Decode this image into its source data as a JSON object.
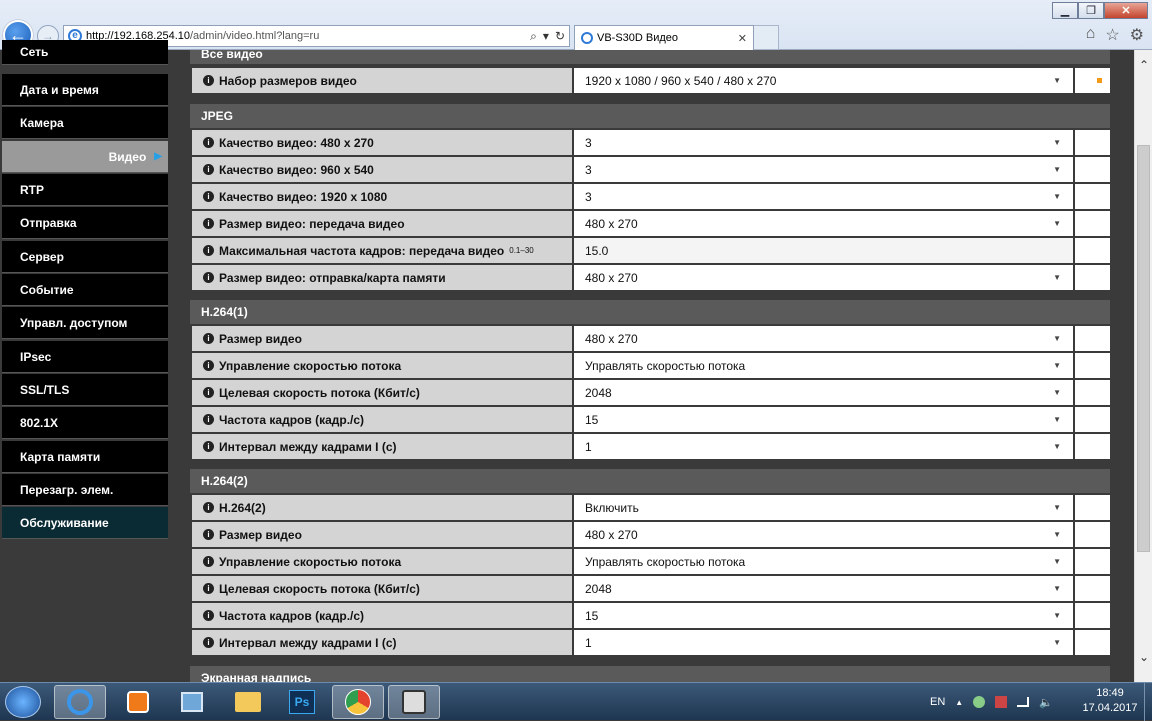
{
  "browser": {
    "url_host": "http://192.168.254.10",
    "url_path": "/admin/video.html?lang=ru",
    "tab_title": "VB-S30D Видео",
    "win_min": "▁",
    "win_max": "❐",
    "win_close": "✕",
    "tab_close": "✕",
    "search_icon": "⌕",
    "refresh_icon": "↻",
    "dropdown_icon": "▾",
    "back_glyph": "←",
    "fwd_glyph": "→",
    "home_glyph": "⌂",
    "star_glyph": "☆",
    "gear_glyph": "⚙"
  },
  "sidebar": {
    "items": [
      {
        "label": "Сеть"
      },
      {
        "label": "Дата и время"
      },
      {
        "label": "Камера"
      },
      {
        "label": "Видео"
      },
      {
        "label": "RTP"
      },
      {
        "label": "Отправка"
      },
      {
        "label": "Сервер"
      },
      {
        "label": "Событие"
      },
      {
        "label": "Управл. доступом"
      },
      {
        "label": "IPsec"
      },
      {
        "label": "SSL/TLS"
      },
      {
        "label": "802.1X"
      },
      {
        "label": "Карта памяти"
      },
      {
        "label": "Перезагр. элем."
      },
      {
        "label": "Обслуживание"
      }
    ],
    "active_arrow": "▶"
  },
  "main": {
    "all_video": {
      "title": "Все видео",
      "rows": [
        {
          "label": "Набор размеров видео",
          "value": "1920 x 1080 / 960 x 540 / 480 x 270"
        }
      ]
    },
    "jpeg": {
      "title": "JPEG",
      "rows": [
        {
          "label": "Качество видео: 480 x 270",
          "value": "3"
        },
        {
          "label": "Качество видео: 960 x 540",
          "value": "3"
        },
        {
          "label": "Качество видео: 1920 x 1080",
          "value": "3"
        },
        {
          "label": "Размер видео: передача видео",
          "value": "480 x 270"
        },
        {
          "label": "Максимальная частота кадров: передача видео",
          "range": "0.1–30",
          "value": "15.0"
        },
        {
          "label": "Размер видео: отправка/карта памяти",
          "value": "480 x 270"
        }
      ]
    },
    "h264_1": {
      "title": "H.264(1)",
      "rows": [
        {
          "label": "Размер видео",
          "value": "480 x 270"
        },
        {
          "label": "Управление скоростью потока",
          "value": "Управлять скоростью потока"
        },
        {
          "label": "Целевая скорость потока (Кбит/с)",
          "value": "2048"
        },
        {
          "label": "Частота кадров (кадр./с)",
          "value": "15"
        },
        {
          "label": "Интервал между кадрами I (с)",
          "value": "1"
        }
      ]
    },
    "h264_2": {
      "title": "H.264(2)",
      "rows": [
        {
          "label": "H.264(2)",
          "value": "Включить"
        },
        {
          "label": "Размер видео",
          "value": "480 x 270"
        },
        {
          "label": "Управление скоростью потока",
          "value": "Управлять скоростью потока"
        },
        {
          "label": "Целевая скорость потока (Кбит/с)",
          "value": "2048"
        },
        {
          "label": "Частота кадров (кадр./с)",
          "value": "15"
        },
        {
          "label": "Интервал между кадрами I (с)",
          "value": "1"
        }
      ]
    },
    "overlay": {
      "title": "Экранная надпись"
    },
    "info_glyph": "i",
    "select_arrow": "▼"
  },
  "taskbar": {
    "lang": "EN",
    "time": "18:49",
    "date": "17.04.2017",
    "ps_label": "Ps",
    "tray_up": "▲",
    "volume_glyph": "🔈"
  },
  "colors": {
    "accent_arrow": "#26a0e6",
    "changed_marker": "#f39a16",
    "nav_bg": "#000000",
    "section_bg": "#5a5a5a"
  }
}
